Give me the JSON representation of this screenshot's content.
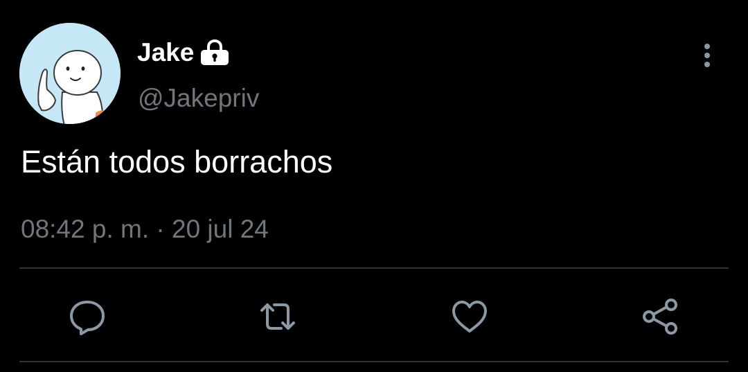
{
  "tweet": {
    "display_name": "Jake",
    "handle": "@Jakepriv",
    "text": "Están todos borrachos",
    "timestamp": "08:42 p. m. · 20 jul 24",
    "locked": true
  },
  "icons": {
    "lock": "lock-icon",
    "more": "more-vertical-icon",
    "reply": "reply-icon",
    "retweet": "retweet-icon",
    "like": "heart-icon",
    "share": "share-icon"
  },
  "colors": {
    "background": "#000000",
    "primary_text": "#ffffff",
    "secondary_text": "#71767b",
    "divider": "#2f3336",
    "action_icon": "#8b98a5",
    "avatar_bg": "#c6e8f6"
  }
}
